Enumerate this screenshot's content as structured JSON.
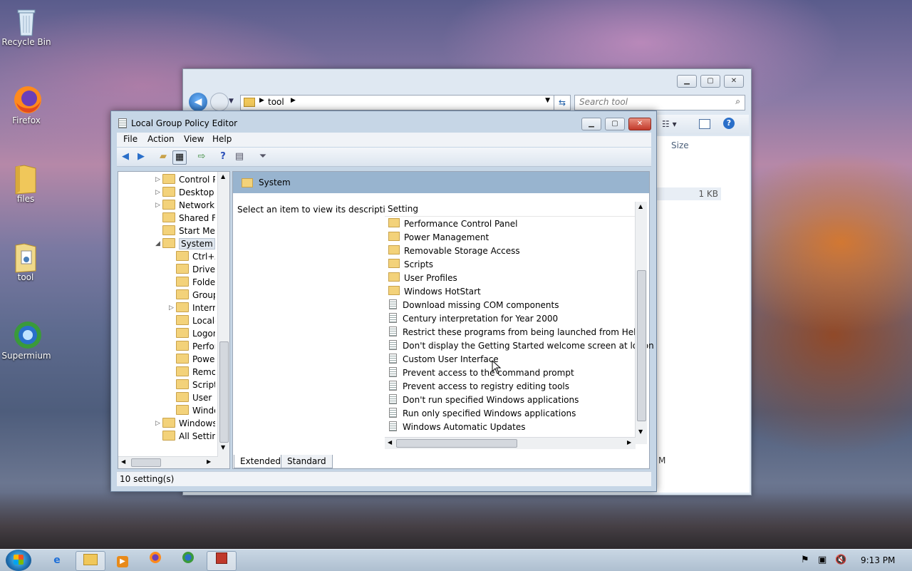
{
  "desktop": {
    "icons": [
      {
        "label": "Recycle Bin",
        "icon": "recycle-bin-icon"
      },
      {
        "label": "Firefox",
        "icon": "firefox-icon"
      },
      {
        "label": "files",
        "icon": "folder-icon"
      },
      {
        "label": "tool",
        "icon": "folder-icon"
      },
      {
        "label": "Supermium",
        "icon": "supermium-icon"
      }
    ]
  },
  "explorer": {
    "path_segment": "tool",
    "search_placeholder": "Search tool",
    "column_size": "Size",
    "file_size": "1 KB",
    "partial_letter": "M"
  },
  "gpe": {
    "title": "Local Group Policy Editor",
    "menu": [
      "File",
      "Action",
      "View",
      "Help"
    ],
    "tree": [
      {
        "label": "Control Pa",
        "indent": 0,
        "arrow": "▷"
      },
      {
        "label": "Desktop",
        "indent": 0,
        "arrow": "▷"
      },
      {
        "label": "Network",
        "indent": 0,
        "arrow": "▷"
      },
      {
        "label": "Shared Fol",
        "indent": 0,
        "arrow": ""
      },
      {
        "label": "Start Menu",
        "indent": 0,
        "arrow": ""
      },
      {
        "label": "System",
        "indent": 0,
        "arrow": "◢",
        "selected": true
      },
      {
        "label": "Ctrl+A",
        "indent": 1,
        "arrow": ""
      },
      {
        "label": "Driver I",
        "indent": 1,
        "arrow": ""
      },
      {
        "label": "Folder",
        "indent": 1,
        "arrow": ""
      },
      {
        "label": "Group",
        "indent": 1,
        "arrow": ""
      },
      {
        "label": "Interne",
        "indent": 1,
        "arrow": "▷"
      },
      {
        "label": "Locale",
        "indent": 1,
        "arrow": ""
      },
      {
        "label": "Logon",
        "indent": 1,
        "arrow": ""
      },
      {
        "label": "Perforn",
        "indent": 1,
        "arrow": ""
      },
      {
        "label": "Power",
        "indent": 1,
        "arrow": ""
      },
      {
        "label": "Remov",
        "indent": 1,
        "arrow": ""
      },
      {
        "label": "Scripts",
        "indent": 1,
        "arrow": ""
      },
      {
        "label": "User Pr",
        "indent": 1,
        "arrow": ""
      },
      {
        "label": "Windo",
        "indent": 1,
        "arrow": ""
      },
      {
        "label": "Windows C",
        "indent": 0,
        "arrow": "▷"
      },
      {
        "label": "All Setting",
        "indent": 0,
        "arrow": ""
      }
    ],
    "header_title": "System",
    "description": "Select an item to view its description.",
    "column_setting": "Setting",
    "settings": [
      {
        "label": "Performance Control Panel",
        "type": "folder"
      },
      {
        "label": "Power Management",
        "type": "folder"
      },
      {
        "label": "Removable Storage Access",
        "type": "folder"
      },
      {
        "label": "Scripts",
        "type": "folder"
      },
      {
        "label": "User Profiles",
        "type": "folder"
      },
      {
        "label": "Windows HotStart",
        "type": "folder"
      },
      {
        "label": "Download missing COM components",
        "type": "policy"
      },
      {
        "label": "Century interpretation for Year 2000",
        "type": "policy"
      },
      {
        "label": "Restrict these programs from being launched from Help",
        "type": "policy"
      },
      {
        "label": "Don't display the Getting Started welcome screen at logon",
        "type": "policy"
      },
      {
        "label": "Custom User Interface",
        "type": "policy"
      },
      {
        "label": "Prevent access to the command prompt",
        "type": "policy"
      },
      {
        "label": "Prevent access to registry editing tools",
        "type": "policy"
      },
      {
        "label": "Don't run specified Windows applications",
        "type": "policy"
      },
      {
        "label": "Run only specified Windows applications",
        "type": "policy"
      },
      {
        "label": "Windows Automatic Updates",
        "type": "policy"
      }
    ],
    "tabs": [
      "Extended",
      "Standard"
    ],
    "status": "10 setting(s)"
  },
  "taskbar": {
    "clock": "9:13 PM",
    "apps": [
      "ie-icon",
      "explorer-icon",
      "media-player-icon",
      "firefox-icon",
      "supermium-icon",
      "gpedit-icon"
    ]
  }
}
